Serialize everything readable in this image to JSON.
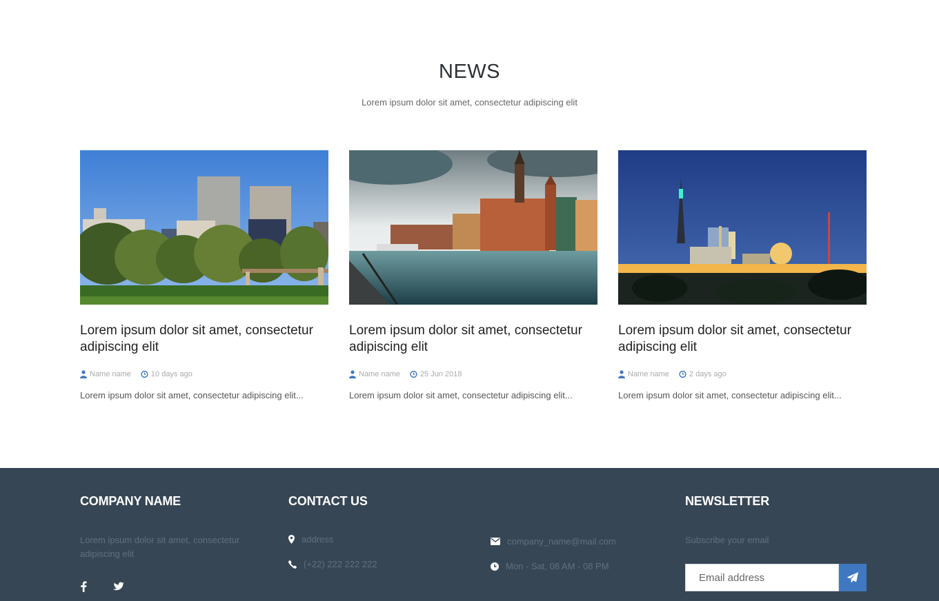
{
  "news": {
    "title": "NEWS",
    "subtitle": "Lorem ipsum dolor sit amet, consectetur adipiscing elit",
    "articles": [
      {
        "image": "city-park-skyline",
        "title": "Lorem ipsum dolor sit amet, consectetur adipiscing elit",
        "author": "Name name",
        "date": "10 days ago",
        "excerpt": "Lorem ipsum dolor sit amet, consectetur adipiscing elit..."
      },
      {
        "image": "riverside-old-town",
        "title": "Lorem ipsum dolor sit amet, consectetur adipiscing elit",
        "author": "Name name",
        "date": "25 Jun 2018",
        "excerpt": "Lorem ipsum dolor sit amet, consectetur adipiscing elit..."
      },
      {
        "image": "night-city-skyline",
        "title": "Lorem ipsum dolor sit amet, consectetur adipiscing elit",
        "author": "Name name",
        "date": "2 days ago",
        "excerpt": "Lorem ipsum dolor sit amet, consectetur adipiscing elit..."
      }
    ]
  },
  "footer": {
    "company": {
      "heading": "COMPANY NAME",
      "text": "Lorem ipsum dolor sit amet, consectetur adipiscing elit"
    },
    "contact": {
      "heading": "CONTACT US",
      "address": "address",
      "phone": "(+22) 222 222 222",
      "email": "company_name@mail.com",
      "hours": "Mon - Sat, 08 AM - 08 PM"
    },
    "newsletter": {
      "heading": "NEWSLETTER",
      "label": "Subscribe your email",
      "placeholder": "Email address"
    },
    "social": [
      "facebook-icon",
      "twitter-icon"
    ]
  },
  "colors": {
    "footer_bg": "#374655",
    "accent": "#3f78c0",
    "meta_icon": "#3f78c0"
  }
}
